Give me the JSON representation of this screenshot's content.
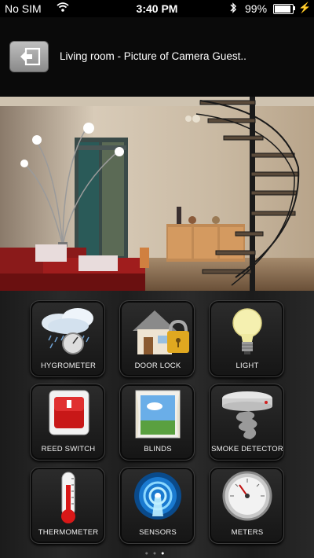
{
  "status_bar": {
    "carrier": "No SIM",
    "time": "3:40 PM",
    "battery": "99%"
  },
  "header": {
    "title": "Living room - Picture of Camera Guest.."
  },
  "tiles": [
    {
      "label": "HYGROMETER",
      "icon": "hygrometer-icon"
    },
    {
      "label": "DOOR LOCK",
      "icon": "door-lock-icon"
    },
    {
      "label": "LIGHT",
      "icon": "light-bulb-icon"
    },
    {
      "label": "REED SWITCH",
      "icon": "reed-switch-icon"
    },
    {
      "label": "BLINDS",
      "icon": "blinds-icon"
    },
    {
      "label": "SMOKE DETECTOR",
      "icon": "smoke-detector-icon"
    },
    {
      "label": "THERMOMETER",
      "icon": "thermometer-icon"
    },
    {
      "label": "SENSORS",
      "icon": "sensors-icon"
    },
    {
      "label": "METERS",
      "icon": "meters-icon"
    }
  ],
  "page_indicator": {
    "count": 3,
    "active": 2
  }
}
